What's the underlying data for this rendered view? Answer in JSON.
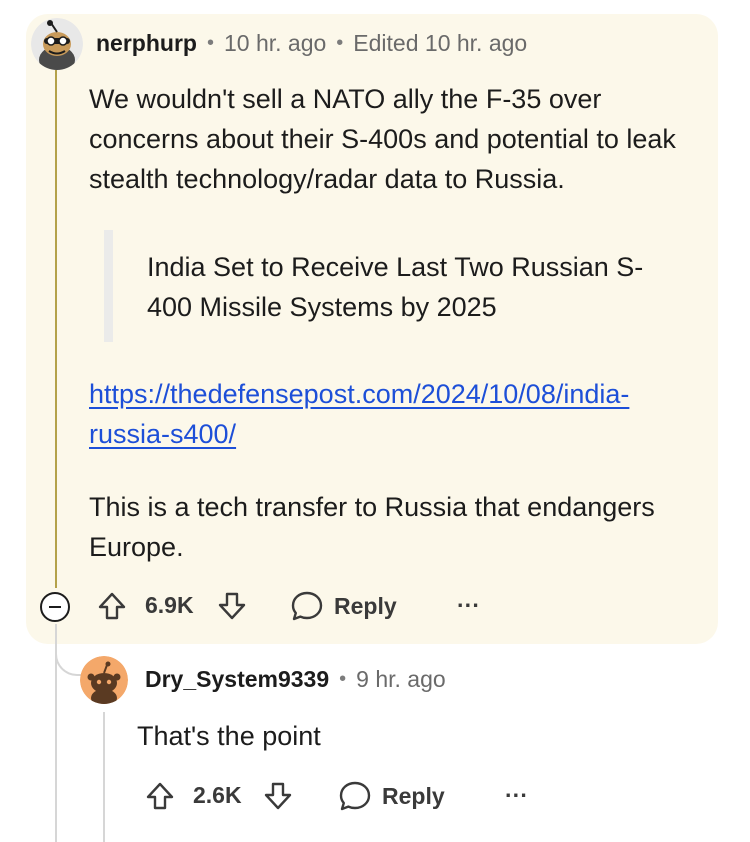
{
  "comments": [
    {
      "username": "nerphurp",
      "time": "10 hr. ago",
      "edited": "Edited 10 hr. ago",
      "paragraph1": "We wouldn't sell a NATO ally the F-35 over concerns about their S-400s and potential to leak stealth technology/radar data to Russia.",
      "quote": "India Set to Receive Last Two Russian S-400 Missile Systems by 2025",
      "link": "https://thedefensepost.com/2024/10/08/india-russia-s400/",
      "paragraph3": "This is a tech transfer to Russia that endangers Europe.",
      "votes": "6.9K",
      "reply_label": "Reply",
      "more_label": "···"
    },
    {
      "username": "Dry_System9339",
      "time": "9 hr. ago",
      "text": "That's the point",
      "votes": "2.6K",
      "reply_label": "Reply",
      "more_label": "···"
    }
  ],
  "icons": {
    "upvote": "arrow-up-icon",
    "downvote": "arrow-down-icon",
    "reply": "speech-bubble-icon",
    "more": "ellipsis-icon",
    "collapse": "minus-circle-icon"
  },
  "colors": {
    "card_bg": "#fcf8ea",
    "link": "#1d4fd8",
    "thread_line_highlight": "#b4a24a",
    "thread_line": "#d6d6d6",
    "avatar2_bg": "#f4a86a"
  }
}
